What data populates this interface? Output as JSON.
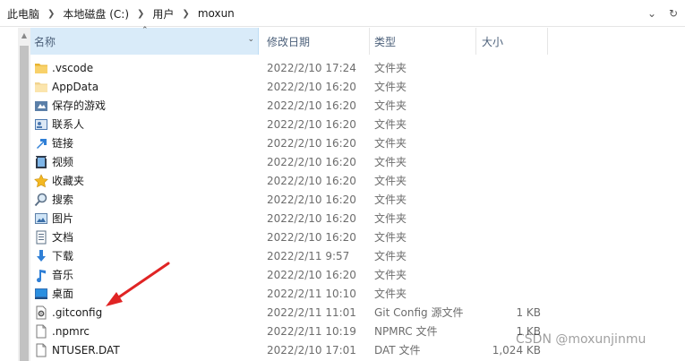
{
  "address_bar": {
    "path": [
      "此电脑",
      "本地磁盘 (C:)",
      "用户",
      "moxun"
    ],
    "dropdown_icon": "chevron-down-icon",
    "refresh_icon": "refresh-icon"
  },
  "columns": {
    "name": "名称",
    "date_modified": "修改日期",
    "type": "类型",
    "size": "大小",
    "sorted_by": "name"
  },
  "files": [
    {
      "name": ".vscode",
      "date": "2022/2/10 17:24",
      "type": "文件夹",
      "size": "",
      "icon": "folder-icon"
    },
    {
      "name": "AppData",
      "date": "2022/2/10 16:20",
      "type": "文件夹",
      "size": "",
      "icon": "folder-hidden-icon"
    },
    {
      "name": "保存的游戏",
      "date": "2022/2/10 16:20",
      "type": "文件夹",
      "size": "",
      "icon": "saved-games-icon"
    },
    {
      "name": "联系人",
      "date": "2022/2/10 16:20",
      "type": "文件夹",
      "size": "",
      "icon": "contacts-icon"
    },
    {
      "name": "链接",
      "date": "2022/2/10 16:20",
      "type": "文件夹",
      "size": "",
      "icon": "links-icon"
    },
    {
      "name": "视频",
      "date": "2022/2/10 16:20",
      "type": "文件夹",
      "size": "",
      "icon": "videos-icon"
    },
    {
      "name": "收藏夹",
      "date": "2022/2/10 16:20",
      "type": "文件夹",
      "size": "",
      "icon": "favorites-icon"
    },
    {
      "name": "搜索",
      "date": "2022/2/10 16:20",
      "type": "文件夹",
      "size": "",
      "icon": "searches-icon"
    },
    {
      "name": "图片",
      "date": "2022/2/10 16:20",
      "type": "文件夹",
      "size": "",
      "icon": "pictures-icon"
    },
    {
      "name": "文档",
      "date": "2022/2/10 16:20",
      "type": "文件夹",
      "size": "",
      "icon": "documents-icon"
    },
    {
      "name": "下载",
      "date": "2022/2/11 9:57",
      "type": "文件夹",
      "size": "",
      "icon": "downloads-icon"
    },
    {
      "name": "音乐",
      "date": "2022/2/10 16:20",
      "type": "文件夹",
      "size": "",
      "icon": "music-icon"
    },
    {
      "name": "桌面",
      "date": "2022/2/11 10:10",
      "type": "文件夹",
      "size": "",
      "icon": "desktop-icon"
    },
    {
      "name": ".gitconfig",
      "date": "2022/2/11 11:01",
      "type": "Git Config 源文件",
      "size": "1 KB",
      "icon": "gear-file-icon"
    },
    {
      "name": ".npmrc",
      "date": "2022/2/11 10:19",
      "type": "NPMRC 文件",
      "size": "1 KB",
      "icon": "file-icon"
    },
    {
      "name": "NTUSER.DAT",
      "date": "2022/2/10 17:01",
      "type": "DAT 文件",
      "size": "1,024 KB",
      "icon": "file-icon"
    }
  ],
  "watermark": "CSDN @moxunjinmu",
  "colors": {
    "selected_header": "#d9ebf9",
    "folder": "#f5c33b",
    "arrow": "#e02424"
  }
}
